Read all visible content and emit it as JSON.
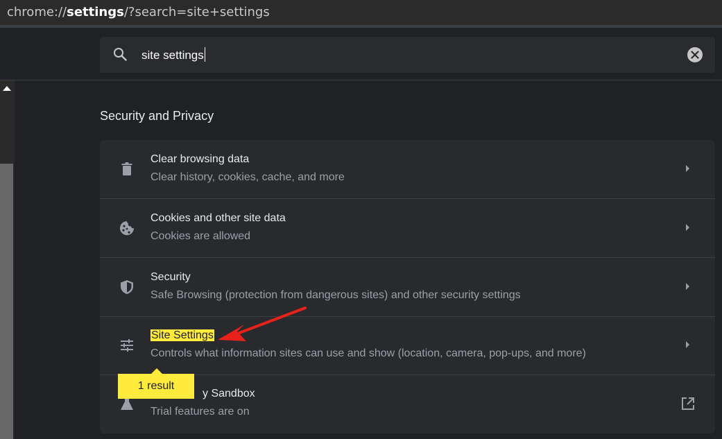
{
  "address_bar": {
    "prefix": "chrome://",
    "host": "settings",
    "suffix": "/?search=site+settings"
  },
  "search": {
    "value": "site settings",
    "icon": "search-icon",
    "clear_icon": "clear-icon"
  },
  "section": {
    "title": "Security and Privacy"
  },
  "rows": [
    {
      "title": "Clear browsing data",
      "subtitle": "Clear history, cookies, cache, and more",
      "icon": "trash-icon"
    },
    {
      "title": "Cookies and other site data",
      "subtitle": "Cookies are allowed",
      "icon": "cookie-icon"
    },
    {
      "title": "Security",
      "subtitle": "Safe Browsing (protection from dangerous sites) and other security settings",
      "icon": "shield-icon"
    },
    {
      "title": "Site Settings",
      "subtitle": "Controls what information sites can use and show (location, camera, pop-ups, and more)",
      "icon": "sliders-icon"
    },
    {
      "title": "Privacy Sandbox",
      "title_visible": "y Sandbox",
      "subtitle": "Trial features are on",
      "icon": "flask-icon"
    }
  ],
  "tooltip": {
    "text": "1 result"
  },
  "colors": {
    "highlight": "#ffeb3b",
    "arrow": "#e8221b",
    "background": "#202124"
  }
}
